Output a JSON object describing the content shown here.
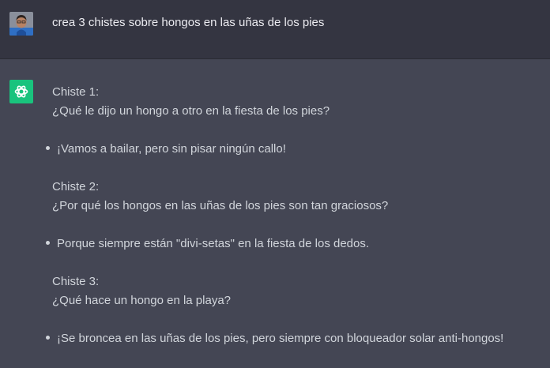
{
  "user_message": {
    "avatar_icon": "user-avatar-icon",
    "text": "crea 3 chistes sobre hongos en las uñas de los pies"
  },
  "assistant_message": {
    "avatar_icon": "openai-logo-icon",
    "accent_color": "#19c37d",
    "jokes": [
      {
        "title": "Chiste 1:",
        "question": "¿Qué le dijo un hongo a otro en la fiesta de los pies?",
        "answer": "¡Vamos a bailar, pero sin pisar ningún callo!"
      },
      {
        "title": "Chiste 2:",
        "question": "¿Por qué los hongos en las uñas de los pies son tan graciosos?",
        "answer": "Porque siempre están \"divi-setas\" en la fiesta de los dedos."
      },
      {
        "title": "Chiste 3:",
        "question": "¿Qué hace un hongo en la playa?",
        "answer": "¡Se broncea en las uñas de los pies, pero siempre con bloqueador solar anti-hongos!"
      }
    ]
  }
}
